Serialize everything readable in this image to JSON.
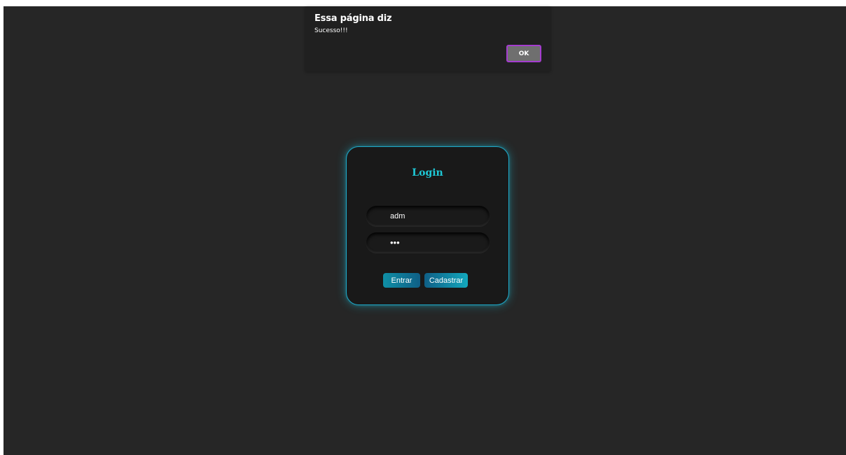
{
  "alert": {
    "title": "Essa página diz",
    "message": "Sucesso!!!",
    "ok_label": "OK"
  },
  "login": {
    "title": "Login",
    "username_value": "adm",
    "password_value": "abc",
    "entrar_label": "Entrar",
    "cadastrar_label": "Cadastrar"
  },
  "colors": {
    "page_background": "#262626",
    "card_background": "#191919",
    "accent": "#1ec8d6",
    "ok_border": "#a53dcf"
  }
}
